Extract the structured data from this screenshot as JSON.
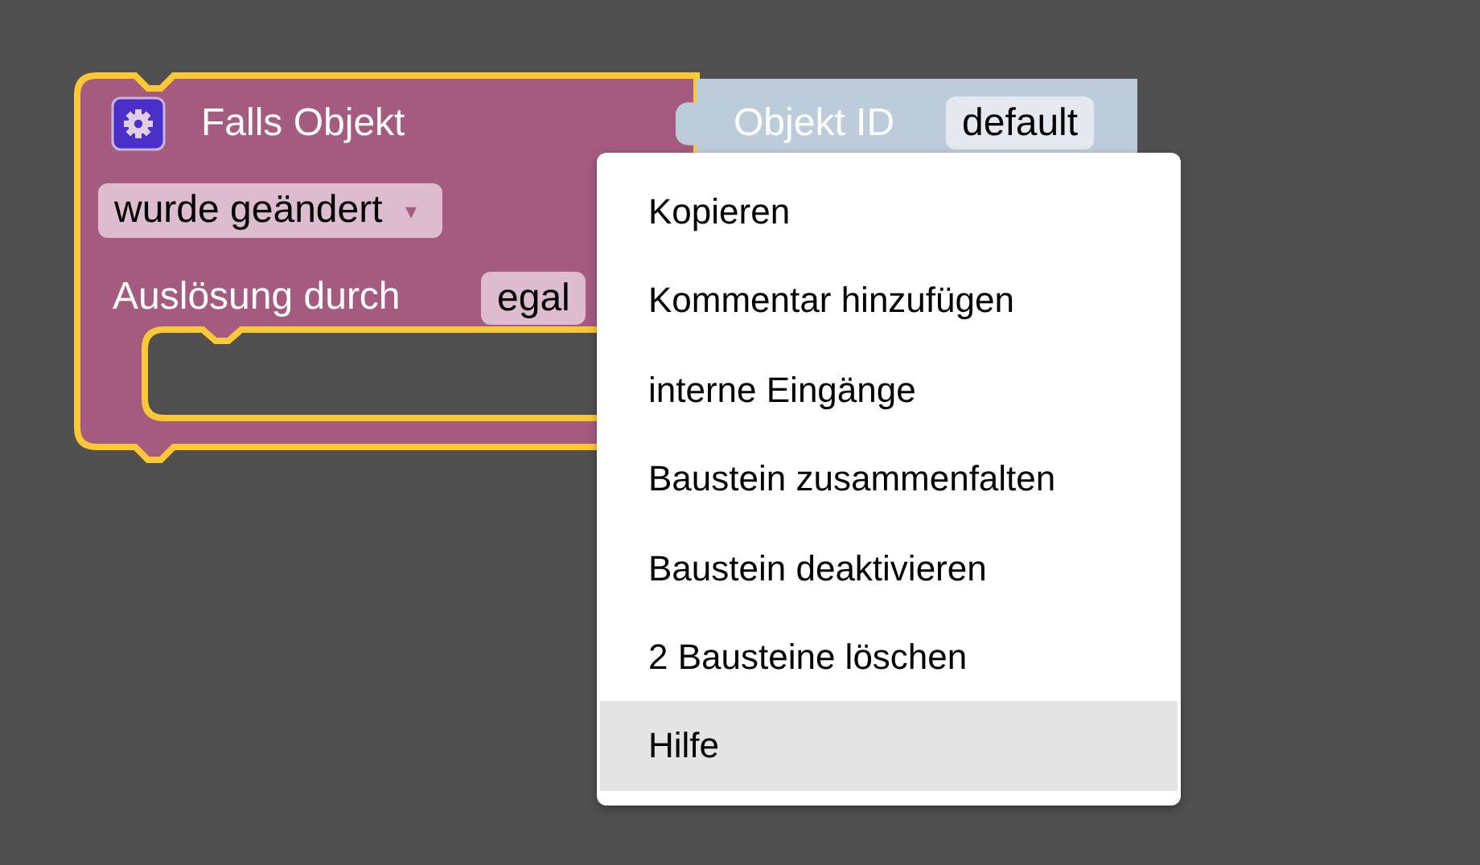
{
  "event_block": {
    "selected": true,
    "title": "Falls Objekt",
    "dropdown": {
      "value": "wurde geändert",
      "arrow": "▾"
    },
    "trigger_label": "Auslösung durch",
    "trigger_value": "egal"
  },
  "value_block": {
    "label": "Objekt ID",
    "value": "default"
  },
  "context_menu": [
    {
      "label": "Kopieren",
      "highlighted": false
    },
    {
      "label": "Kommentar hinzufügen",
      "highlighted": false
    },
    {
      "label": "interne Eingänge",
      "highlighted": false
    },
    {
      "label": "Baustein zusammenfalten",
      "highlighted": false
    },
    {
      "label": "Baustein deaktivieren",
      "highlighted": false
    },
    {
      "label": "2 Bausteine löschen",
      "highlighted": false
    },
    {
      "label": "Hilfe",
      "highlighted": true
    }
  ]
}
